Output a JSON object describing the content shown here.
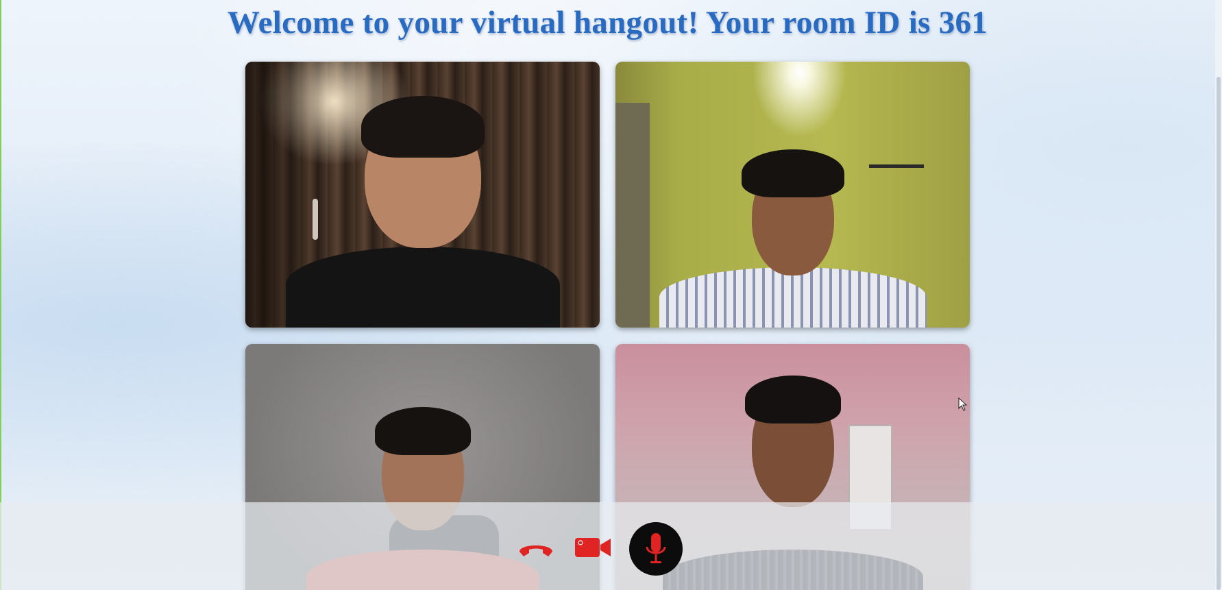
{
  "header": {
    "title": "Welcome to your virtual hangout! Your room ID is 361"
  },
  "participants": [
    {
      "id": "participant-1"
    },
    {
      "id": "participant-2"
    },
    {
      "id": "participant-3"
    },
    {
      "id": "participant-4"
    }
  ],
  "controls": {
    "hangup": {
      "icon": "phone-hangup-icon",
      "color": "#e02424"
    },
    "camera": {
      "icon": "video-camera-icon",
      "color": "#e02424"
    },
    "mic": {
      "icon": "microphone-icon",
      "color": "#e02424",
      "background": "#0c0c0c"
    }
  },
  "colors": {
    "title": "#2a6bc2",
    "accent_red": "#e02424"
  }
}
